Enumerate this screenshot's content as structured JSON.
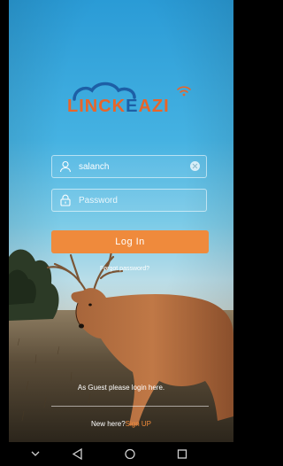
{
  "logo": {
    "part1": "LINCK",
    "part2": "E",
    "part3": "AZI"
  },
  "login": {
    "username_value": "salanch",
    "password_placeholder": "Password",
    "login_button": "Log In",
    "forgot_password": "Forgot password?"
  },
  "guest": {
    "text": "As Guest please login here."
  },
  "signup": {
    "prefix": "New here?",
    "link": "Sign UP"
  },
  "navbar": {
    "items": [
      "chevron-down-icon",
      "back-triangle-icon",
      "home-circle-icon",
      "recents-square-icon"
    ]
  },
  "colors": {
    "accent": "#ef8a3c",
    "brand_blue": "#1d5fa6",
    "brand_orange": "#e8652a"
  }
}
